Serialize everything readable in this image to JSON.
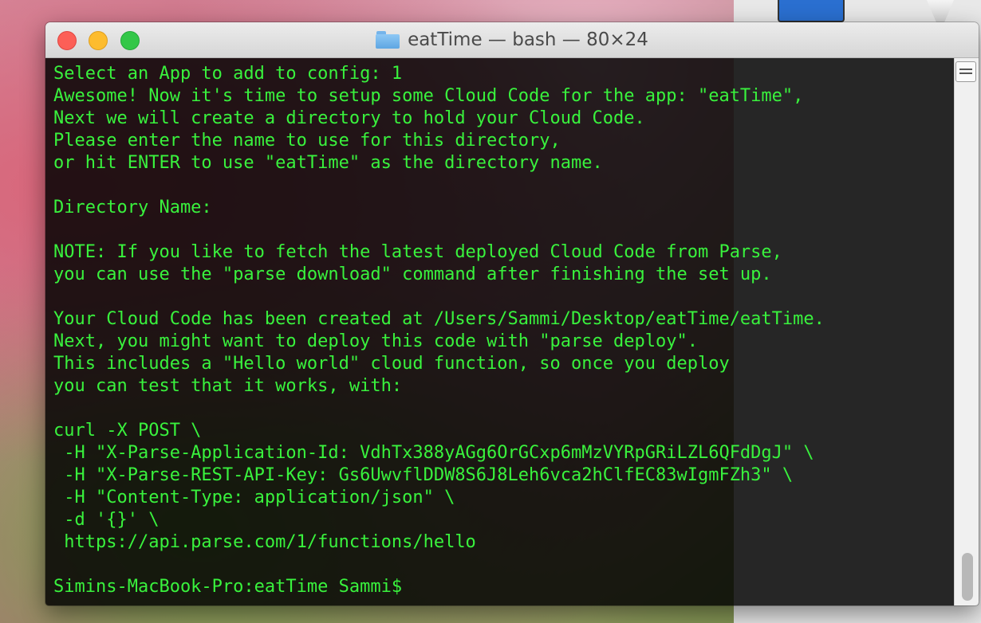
{
  "window": {
    "title": "eatTime — bash — 80×24",
    "folder_icon": "folder-icon"
  },
  "terminal": {
    "text_color": "#39f23d",
    "lines": [
      "Select an App to add to config: 1",
      "Awesome! Now it's time to setup some Cloud Code for the app: \"eatTime\",",
      "Next we will create a directory to hold your Cloud Code.",
      "Please enter the name to use for this directory,",
      "or hit ENTER to use \"eatTime\" as the directory name.",
      "",
      "Directory Name:",
      "",
      "NOTE: If you like to fetch the latest deployed Cloud Code from Parse,",
      "you can use the \"parse download\" command after finishing the set up.",
      "",
      "Your Cloud Code has been created at /Users/Sammi/Desktop/eatTime/eatTime.",
      "Next, you might want to deploy this code with \"parse deploy\".",
      "This includes a \"Hello world\" cloud function, so once you deploy",
      "you can test that it works, with:",
      "",
      "curl -X POST \\",
      " -H \"X-Parse-Application-Id: VdhTx388yAGg6OrGCxp6mMzVYRpGRiLZL6QFdDgJ\" \\",
      " -H \"X-Parse-REST-API-Key: Gs6UwvflDDW8S6J8Leh6vca2hClfEC83wIgmFZh3\" \\",
      " -H \"Content-Type: application/json\" \\",
      " -d '{}' \\",
      " https://api.parse.com/1/functions/hello",
      "",
      "Simins-MacBook-Pro:eatTime Sammi$"
    ]
  }
}
